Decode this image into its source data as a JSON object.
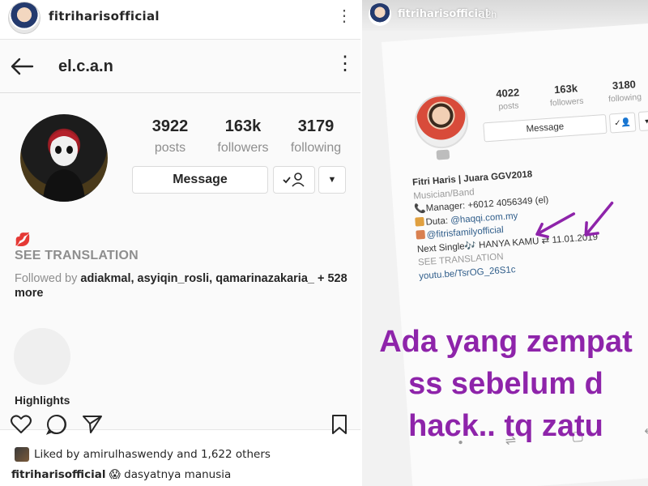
{
  "post": {
    "username": "fitriharisofficial",
    "menu_icon": "more-vertical-icon",
    "liked_by": "Liked by amirulhaswendy and 1,622 others",
    "caption_user": "fitriharisofficial",
    "caption_text": "😱 dasyatnya manusia"
  },
  "left_shot": {
    "username": "el.c.a.n",
    "stats": [
      {
        "num": "3922",
        "label": "posts"
      },
      {
        "num": "163k",
        "label": "followers"
      },
      {
        "num": "3179",
        "label": "following"
      }
    ],
    "message_label": "Message",
    "bio_emoji": "💋",
    "see_translation": "SEE TRANSLATION",
    "followed_by_prefix": "Followed by ",
    "followed_by_names": "adiakmal, asyiqin_rosli, qamarinazakaria_",
    "followed_by_suffix": " + 528 more",
    "highlights_label": "Highlights"
  },
  "story": {
    "username": "fitriharisofficial",
    "time": "12h",
    "stats": [
      {
        "num": "4022",
        "label": "posts"
      },
      {
        "num": "163k",
        "label": "followers"
      },
      {
        "num": "3180",
        "label": "following"
      }
    ],
    "message_label": "Message",
    "bio": {
      "name": "Fitri Haris | Juara GGV2018",
      "category": "Musician/Band",
      "manager": "Manager: +6012 4056349 (el)",
      "duta_prefix": "Duta: ",
      "duta_link": "@haqqi.com.my",
      "family_link": "@fitrisfamilyofficial",
      "single": "Next Single🎶 HANYA KAMU ⇄ 11.01.2019",
      "see_translation": "SEE TRANSLATION",
      "link": "youtu.be/TsrOG_26S1c"
    },
    "overlay_lines": [
      "Ada yang zempat",
      "ss sebelum d",
      "hack.. tq zatu"
    ],
    "overlay_color": "#8e24aa"
  }
}
